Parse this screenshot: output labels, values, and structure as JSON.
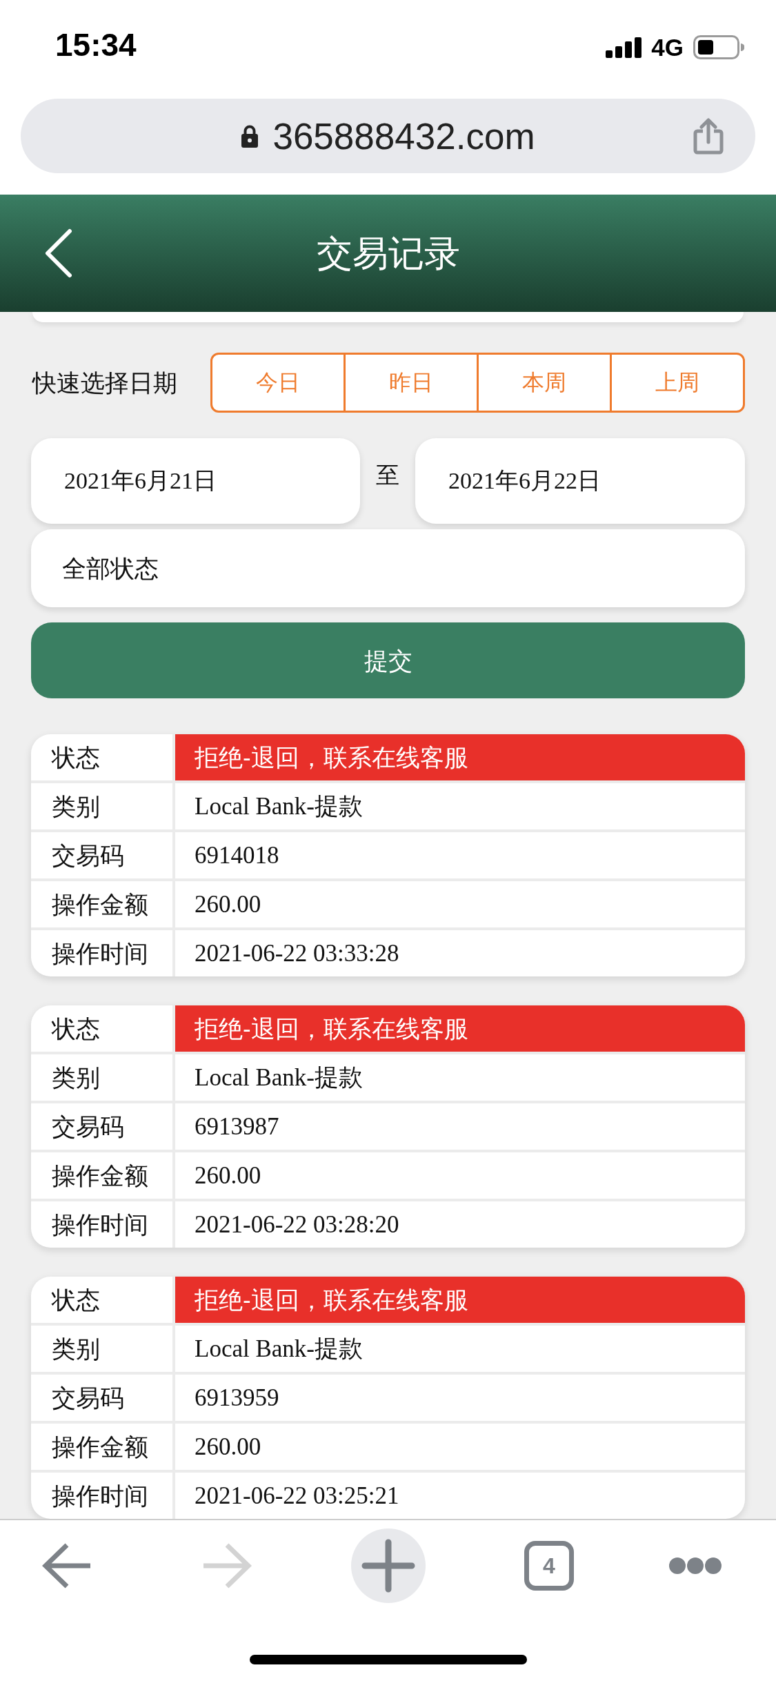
{
  "status_bar": {
    "time": "15:34",
    "network": "4G"
  },
  "browser": {
    "url": "365888432.com"
  },
  "header": {
    "title": "交易记录"
  },
  "quick_date": {
    "label": "快速选择日期",
    "options": [
      {
        "label": "今日",
        "selected": false
      },
      {
        "label": "昨日",
        "selected": false
      },
      {
        "label": "本周",
        "selected": false
      },
      {
        "label": "上周",
        "selected": false
      }
    ]
  },
  "date_range": {
    "from": "2021年6月21日",
    "separator": "至",
    "to": "2021年6月22日"
  },
  "status_filter": {
    "value": "全部状态"
  },
  "submit": {
    "label": "提交"
  },
  "records": [
    {
      "rows": [
        {
          "kind": "status",
          "label": "状态",
          "value": "拒绝-退回，联系在线客服"
        },
        {
          "kind": "text",
          "label": "类别",
          "value": "Local Bank-提款"
        },
        {
          "kind": "text",
          "label": "交易码",
          "value": "6914018"
        },
        {
          "kind": "text",
          "label": "操作金额",
          "value": "260.00"
        },
        {
          "kind": "text",
          "label": "操作时间",
          "value": "2021-06-22 03:33:28"
        }
      ]
    },
    {
      "rows": [
        {
          "kind": "status",
          "label": "状态",
          "value": "拒绝-退回，联系在线客服"
        },
        {
          "kind": "text",
          "label": "类别",
          "value": "Local Bank-提款"
        },
        {
          "kind": "text",
          "label": "交易码",
          "value": "6913987"
        },
        {
          "kind": "text",
          "label": "操作金额",
          "value": "260.00"
        },
        {
          "kind": "text",
          "label": "操作时间",
          "value": "2021-06-22 03:28:20"
        }
      ]
    },
    {
      "rows": [
        {
          "kind": "status",
          "label": "状态",
          "value": "拒绝-退回，联系在线客服"
        },
        {
          "kind": "text",
          "label": "类别",
          "value": "Local Bank-提款"
        },
        {
          "kind": "text",
          "label": "交易码",
          "value": "6913959"
        },
        {
          "kind": "text",
          "label": "操作金额",
          "value": "260.00"
        },
        {
          "kind": "text",
          "label": "操作时间",
          "value": "2021-06-22 03:25:21"
        }
      ]
    }
  ],
  "toolbar": {
    "buttons": [
      {
        "kind": "back",
        "disabled": false
      },
      {
        "kind": "forward",
        "disabled": true
      },
      {
        "kind": "new_tab",
        "disabled": false
      },
      {
        "kind": "tabs",
        "count": "4",
        "disabled": false
      },
      {
        "kind": "more",
        "disabled": false
      }
    ]
  }
}
